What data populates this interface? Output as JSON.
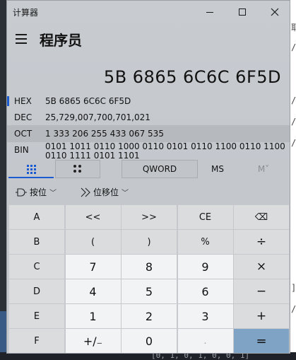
{
  "window": {
    "app_title": "计算器",
    "mode_title": "程序员"
  },
  "display": {
    "value": "5B 6865 6C6C 6F5D"
  },
  "radix": [
    {
      "label": "HEX",
      "value": "5B 6865 6C6C 6F5D",
      "active": true
    },
    {
      "label": "DEC",
      "value": "25,729,007,700,701,021"
    },
    {
      "label": "OCT",
      "value": "1 333 206 255 433 067 535"
    },
    {
      "label": "BIN",
      "value": "0101 1011 0110 1000 0110 0101 0110 1100 0110 1100 0110 1111 0101 1101"
    }
  ],
  "tabs": {
    "word_size": "QWORD",
    "ms": "MS",
    "mplus": "M˅"
  },
  "ops": {
    "bitwise": "按位",
    "bitshift": "位移位"
  },
  "keys": [
    [
      "A",
      "<<",
      ">>",
      "CE",
      "⌫"
    ],
    [
      "B",
      "(",
      ")",
      "%",
      "÷"
    ],
    [
      "C",
      "7",
      "8",
      "9",
      "×"
    ],
    [
      "D",
      "4",
      "5",
      "6",
      "−"
    ],
    [
      "E",
      "1",
      "2",
      "3",
      "+"
    ],
    [
      "F",
      "+/₋",
      "0",
      ".",
      "="
    ]
  ],
  "background": {
    "code_snippet": "[0, 1, 0, 1, 0, 0, 1]"
  }
}
